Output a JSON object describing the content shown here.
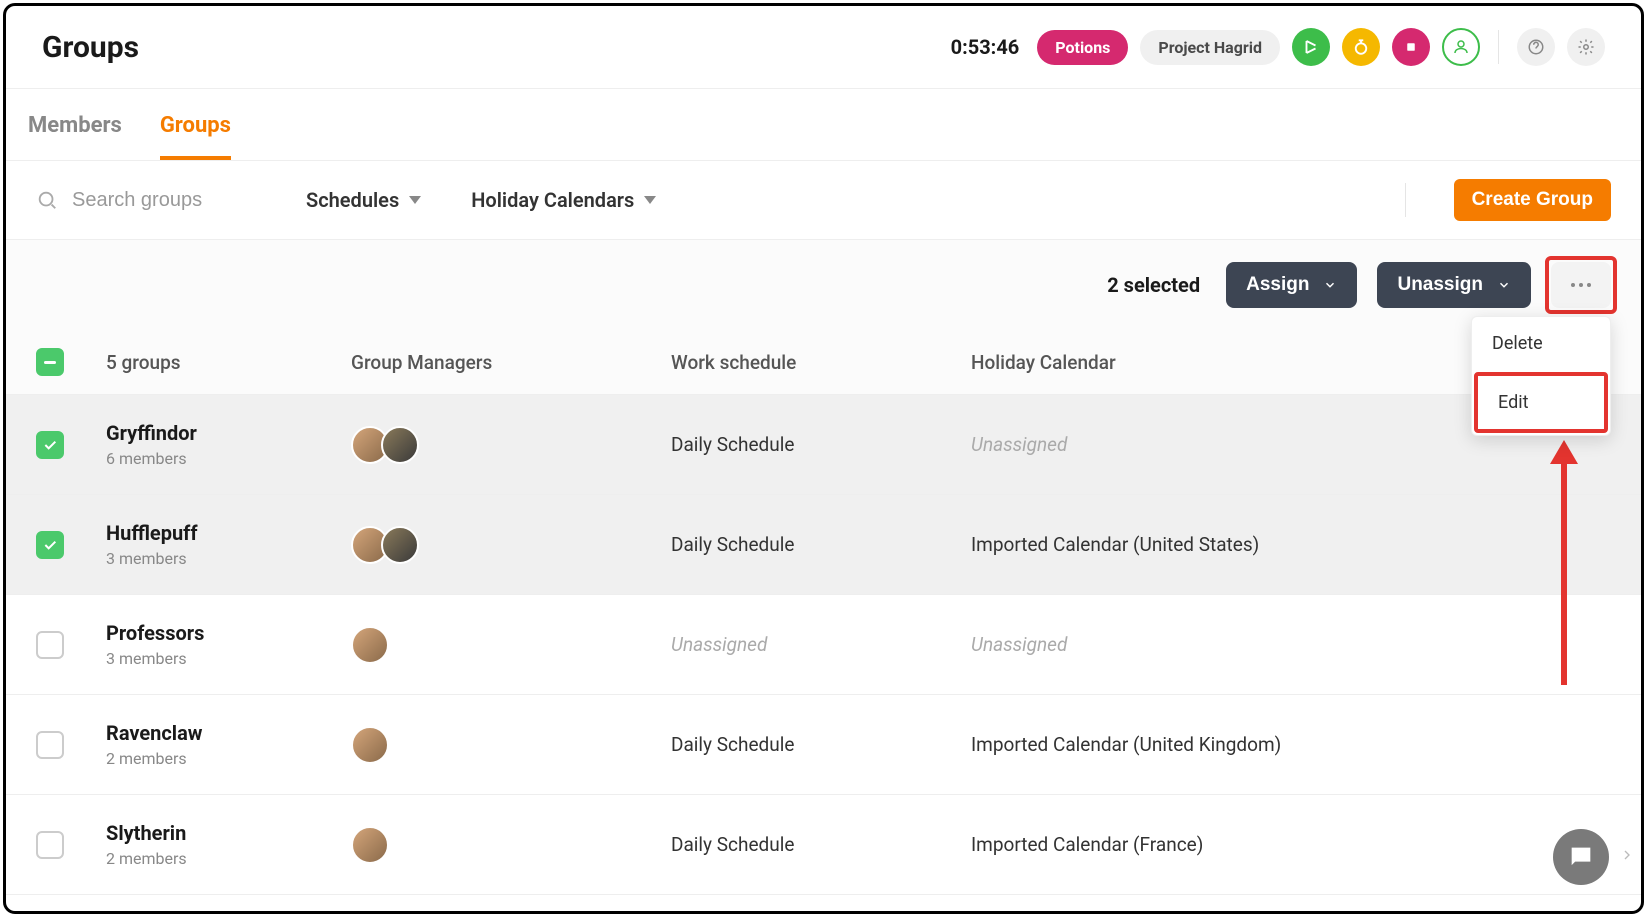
{
  "header": {
    "title": "Groups",
    "timer": "0:53:46",
    "pill_pink": "Potions",
    "pill_gray": "Project Hagrid"
  },
  "tabs": {
    "members": "Members",
    "groups": "Groups",
    "active": "groups"
  },
  "toolbar": {
    "search_placeholder": "Search groups",
    "filter_schedules": "Schedules",
    "filter_holidays": "Holiday Calendars",
    "create_label": "Create Group"
  },
  "actionbar": {
    "selected_text": "2 selected",
    "assign_label": "Assign",
    "unassign_label": "Unassign"
  },
  "menu": {
    "delete": "Delete",
    "edit": "Edit"
  },
  "table": {
    "count_label": "5 groups",
    "col_managers": "Group Managers",
    "col_schedule": "Work schedule",
    "col_holiday": "Holiday Calendar"
  },
  "rows": [
    {
      "name": "Gryffindor",
      "members": "6 members",
      "schedule": "Daily Schedule",
      "schedule_muted": false,
      "holiday": "Unassigned",
      "holiday_muted": true,
      "checked": true,
      "avatars": 2
    },
    {
      "name": "Hufflepuff",
      "members": "3 members",
      "schedule": "Daily Schedule",
      "schedule_muted": false,
      "holiday": "Imported Calendar (United States)",
      "holiday_muted": false,
      "checked": true,
      "avatars": 2
    },
    {
      "name": "Professors",
      "members": "3 members",
      "schedule": "Unassigned",
      "schedule_muted": true,
      "holiday": "Unassigned",
      "holiday_muted": true,
      "checked": false,
      "avatars": 1
    },
    {
      "name": "Ravenclaw",
      "members": "2 members",
      "schedule": "Daily Schedule",
      "schedule_muted": false,
      "holiday": "Imported Calendar (United Kingdom)",
      "holiday_muted": false,
      "checked": false,
      "avatars": 1
    },
    {
      "name": "Slytherin",
      "members": "2 members",
      "schedule": "Daily Schedule",
      "schedule_muted": false,
      "holiday": "Imported Calendar (France)",
      "holiday_muted": false,
      "checked": false,
      "avatars": 1
    }
  ]
}
